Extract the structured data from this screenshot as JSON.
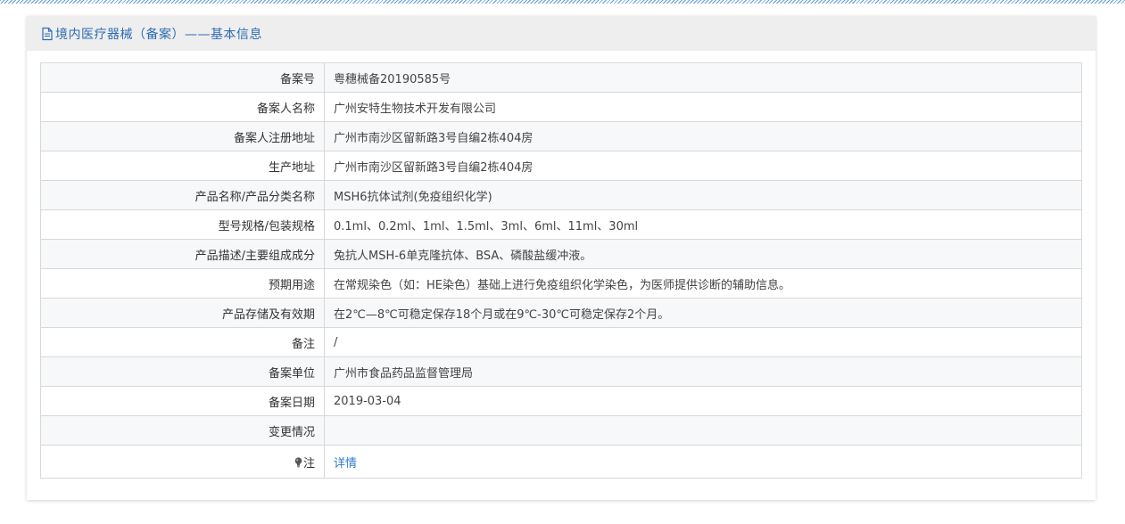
{
  "header": {
    "title": "境内医疗器械（备案）——基本信息",
    "icon": "document-icon"
  },
  "colors": {
    "title": "#2d6bb3",
    "link": "#2d7ad6",
    "header_bg": "#eeeeee",
    "border": "#d8d8d8"
  },
  "rows": [
    {
      "label": "备案号",
      "value": "粤穗械备20190585号"
    },
    {
      "label": "备案人名称",
      "value": "广州安特生物技术开发有限公司"
    },
    {
      "label": "备案人注册地址",
      "value": "广州市南沙区留新路3号自编2栋404房"
    },
    {
      "label": "生产地址",
      "value": "广州市南沙区留新路3号自编2栋404房"
    },
    {
      "label": "产品名称/产品分类名称",
      "value": "MSH6抗体试剂(免疫组织化学)"
    },
    {
      "label": "型号规格/包装规格",
      "value": "0.1ml、0.2ml、1ml、1.5ml、3ml、6ml、11ml、30ml"
    },
    {
      "label": "产品描述/主要组成成分",
      "value": "兔抗人MSH-6单克隆抗体、BSA、磷酸盐缓冲液。"
    },
    {
      "label": "预期用途",
      "value": "在常规染色（如：HE染色）基础上进行免疫组织化学染色，为医师提供诊断的辅助信息。"
    },
    {
      "label": "产品存储及有效期",
      "value": "在2℃—8℃可稳定保存18个月或在9℃-30℃可稳定保存2个月。"
    },
    {
      "label": "备注",
      "value": "/"
    },
    {
      "label": "备案单位",
      "value": "广州市食品药品监督管理局"
    },
    {
      "label": "备案日期",
      "value": "2019-03-04"
    },
    {
      "label": "变更情况",
      "value": ""
    }
  ],
  "note": {
    "label": "注",
    "icon": "lightbulb-icon",
    "link_text": "详情"
  }
}
